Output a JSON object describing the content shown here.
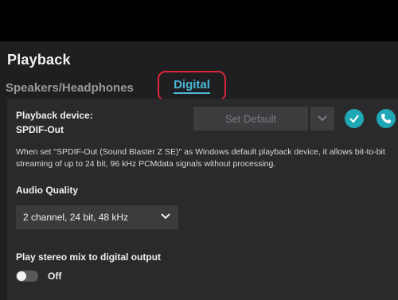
{
  "page": {
    "title": "Playback"
  },
  "tabs": [
    {
      "label": "Speakers/Headphones",
      "active": false
    },
    {
      "label": "Digital",
      "active": true
    }
  ],
  "device": {
    "label": "Playback device:",
    "value": "SPDIF-Out",
    "set_default_label": "Set Default"
  },
  "description": "When set \"SPDIF-Out (Sound Blaster Z SE)\" as Windows default playback device, it allows bit-to-bit streaming of up to 24 bit, 96 kHz PCMdata signals without processing.",
  "audio_quality": {
    "label": "Audio Quality",
    "selected": "2 channel, 24 bit, 48 kHz"
  },
  "stereo_mix": {
    "label": "Play stereo mix to digital output",
    "state": "Off"
  },
  "colors": {
    "accent": "#4bb6d6",
    "highlight_border": "#d9263b",
    "button_teal": "#1fa7b5"
  },
  "icons": [
    "chevron-down-icon",
    "check-icon",
    "phone-icon"
  ]
}
